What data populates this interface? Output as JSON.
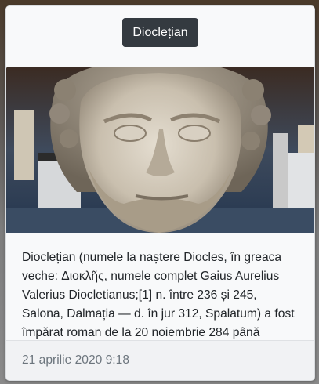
{
  "card": {
    "title_button": "Dioclețian",
    "image": {
      "subject": "marble-portrait-bust-of-diocletian"
    },
    "excerpt": "Dioclețian (numele la naștere Diocles, în greaca veche: Διοκλῆς, numele complet Gaius Aurelius Valerius Diocletianus;[1] n. între 236 și 245, Salona, Dalmația — d. în jur 312, Spalatum) a fost împărat roman de la 20 noiembrie 284 până",
    "timestamp": "21 aprilie 2020 9:18"
  },
  "colors": {
    "button_bg": "#343a40",
    "card_bg": "#f8f9fa",
    "footer_text": "#6c757d",
    "body_text": "#212529"
  }
}
